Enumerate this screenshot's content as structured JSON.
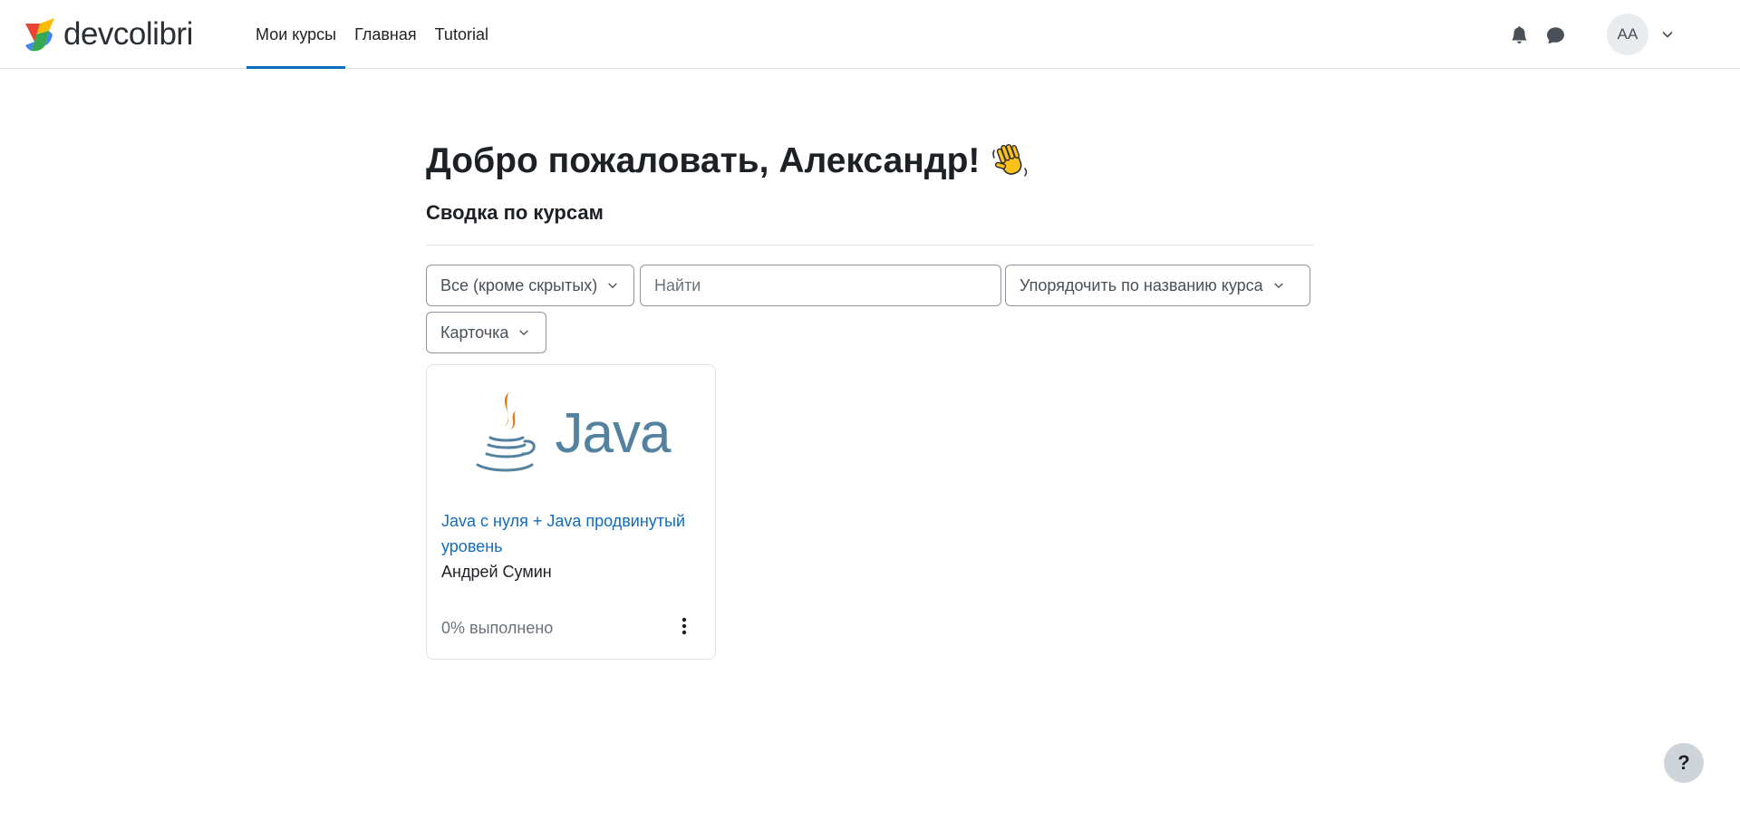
{
  "navbar": {
    "brand": "devcolibri",
    "links": [
      {
        "label": "Мои курсы",
        "active": true
      },
      {
        "label": "Главная",
        "active": false
      },
      {
        "label": "Tutorial",
        "active": false
      }
    ],
    "notifications_icon": "bell-icon",
    "messages_icon": "chat-bubble-icon",
    "user_initials": "AA"
  },
  "main": {
    "title": "Добро пожаловать, Александр!",
    "title_emoji_icon": "waving-hand-icon",
    "section_title": "Сводка по курсам",
    "filters": {
      "grouping": "Все (кроме скрытых)",
      "search_placeholder": "Найти",
      "search_value": "",
      "sort": "Упорядочить по названию курса",
      "view": "Карточка"
    },
    "courses": [
      {
        "image_label": "Java",
        "name": "Java с нуля + Java продвинутый уровень",
        "teacher": "Андрей Сумин",
        "progress_text": "0% выполнено",
        "progress_percent": 0
      }
    ]
  },
  "help": {
    "label": "?"
  },
  "colors": {
    "accent": "#0f6cbf",
    "text": "#1d2125",
    "muted": "#6a737b",
    "border": "#dee2e6",
    "java_blue": "#5382a1",
    "java_orange": "#e76f00"
  }
}
